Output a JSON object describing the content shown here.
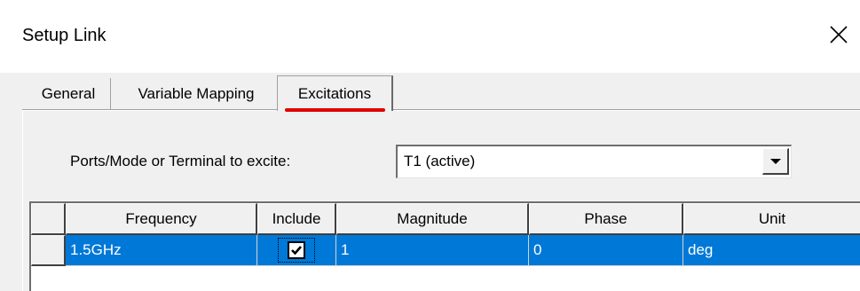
{
  "window": {
    "title": "Setup Link",
    "close_icon": "close-icon"
  },
  "tabs": [
    {
      "label": "General",
      "active": false
    },
    {
      "label": "Variable Mapping",
      "active": false
    },
    {
      "label": "Excitations",
      "active": true
    }
  ],
  "excitation": {
    "ports_label": "Ports/Mode or Terminal to excite:",
    "ports_value": "T1 (active)"
  },
  "table": {
    "columns": [
      "Frequency",
      "Include",
      "Magnitude",
      "Phase",
      "Unit"
    ],
    "rows": [
      {
        "frequency": "1.5GHz",
        "include": true,
        "magnitude": "1",
        "phase": "0",
        "unit": "deg",
        "selected": true
      }
    ]
  },
  "colors": {
    "selection": "#0078d7",
    "active_tab_underline": "#e00000",
    "dialog_bg": "#f0f0f0"
  }
}
